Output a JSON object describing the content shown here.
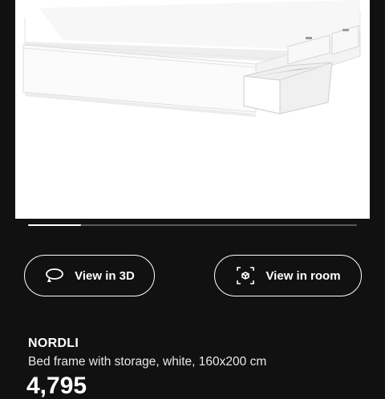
{
  "product_image": {
    "alt_icon": "bed-frame-with-storage-drawers"
  },
  "carousel": {
    "progress_fraction": 0.16
  },
  "actions": {
    "view_3d_label": "View in 3D",
    "view_3d_icon": "rotate-3d-icon",
    "view_room_label": "View in room",
    "view_room_icon": "ar-cube-icon"
  },
  "product": {
    "name": "NORDLI",
    "description": "Bed frame with storage, white, 160x200 cm",
    "price": "4,795"
  },
  "colors": {
    "background": "#111111",
    "text": "#ffffff",
    "image_background": "#ffffff"
  }
}
